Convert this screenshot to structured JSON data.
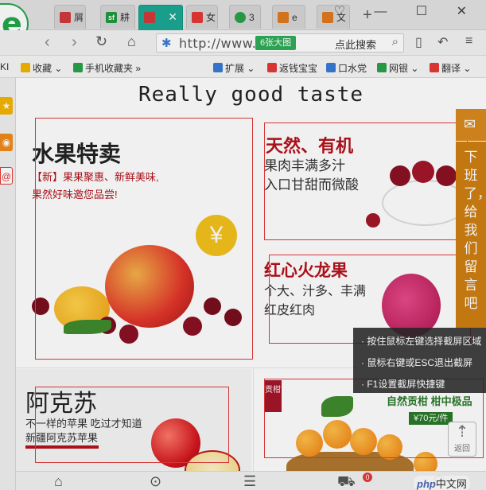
{
  "browser": {
    "logo_letter": "e",
    "tabs": [
      {
        "label": "屑",
        "icon_color": "#d23b3b"
      },
      {
        "label": "耕",
        "icon_color": "#1e9a3e",
        "icon_text": "sf"
      },
      {
        "label": "",
        "icon_color": "#d23b3b",
        "active": true
      },
      {
        "label": "女",
        "icon_color": "#e53935"
      },
      {
        "label": "3",
        "icon_color": "#2aa14a"
      },
      {
        "label": "e",
        "icon_color": "#e07a1f"
      },
      {
        "label": "文",
        "icon_color": "#e07a1f"
      }
    ],
    "active_tab_close": "✕",
    "new_tab": "+",
    "window_buttons": "♡ — ☐ ✕",
    "address": "http://www.:",
    "badge": "6张大图",
    "search_label": "点此搜索",
    "bookmarks": [
      {
        "label": "KI",
        "icon_color": ""
      },
      {
        "label": "收藏 ⌄",
        "icon_color": "#f4b400"
      },
      {
        "label": "手机收藏夹 »",
        "icon_color": "#2aa14a"
      },
      {
        "label": "扩展 ⌄",
        "icon_color": "#3a7bd5"
      },
      {
        "label": "返钱宝宝",
        "icon_color": "#e53935"
      },
      {
        "label": "口水党",
        "icon_color": "#3a7bd5"
      },
      {
        "label": "网银 ⌄",
        "icon_color": "#2aa14a"
      },
      {
        "label": "翻译 ⌄",
        "icon_color": "#e53935"
      }
    ]
  },
  "page": {
    "heading": "Really good taste",
    "fruit_sale": {
      "title": "水果特卖",
      "line1": "【新】果果聚惠、新鲜美味,",
      "line2": "果然好味邀您品尝!",
      "price_symbol": "¥"
    },
    "cherry": {
      "title": "天然、有机",
      "line1": "果肉丰满多汁",
      "line2": "入口甘甜而微酸"
    },
    "dragon": {
      "title": "红心火龙果",
      "line1": "个大、汁多、丰满",
      "line2": "红皮红肉"
    },
    "aksu": {
      "title": "阿克苏",
      "line1": "不一样的苹果 吃过才知道",
      "line2": "新疆阿克苏苹果"
    },
    "orange": {
      "tag": "贡柑",
      "title": "自然贡柑 柑中极品",
      "price": "¥70元/件"
    }
  },
  "screenshot_hints": [
    "· 按住鼠标左键选择截屏区域",
    "· 鼠标右键或ESC退出截屏",
    "· F1设置截屏快捷键"
  ],
  "side_panel": {
    "mail_icon": "✉",
    "text": "下班了，给我们留言吧"
  },
  "back_to_top": "返回",
  "cart_count": "0",
  "watermark": "中文网",
  "watermark_brand": "php"
}
